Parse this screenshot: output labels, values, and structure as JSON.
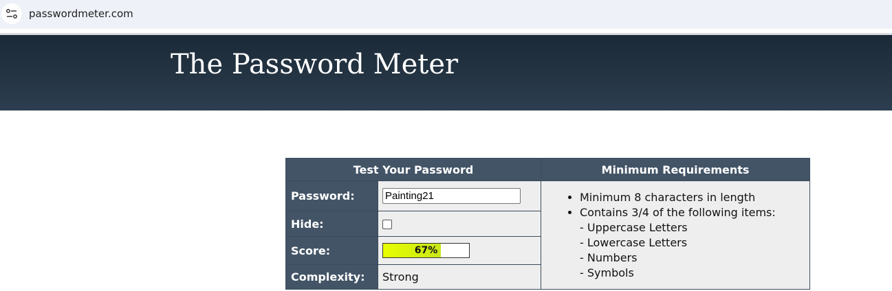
{
  "browser": {
    "url": "passwordmeter.com"
  },
  "header": {
    "title": "The Password Meter"
  },
  "table": {
    "left_heading": "Test Your Password",
    "right_heading": "Minimum Requirements",
    "password_label": "Password:",
    "password_value": "Painting21",
    "hide_label": "Hide:",
    "hide_checked": false,
    "score_label": "Score:",
    "score_text": "67%",
    "score_fraction": 0.67,
    "complexity_label": "Complexity:",
    "complexity_value": "Strong"
  },
  "requirements": {
    "items": [
      "Minimum 8 characters in length",
      "Contains 3/4 of the following items:"
    ],
    "sub_items": [
      "- Uppercase Letters",
      "- Lowercase Letters",
      "- Numbers",
      "- Symbols"
    ]
  },
  "colors": {
    "header_bg": "#243443",
    "table_header_bg": "#435466",
    "score_fill": "#e8ff00"
  }
}
